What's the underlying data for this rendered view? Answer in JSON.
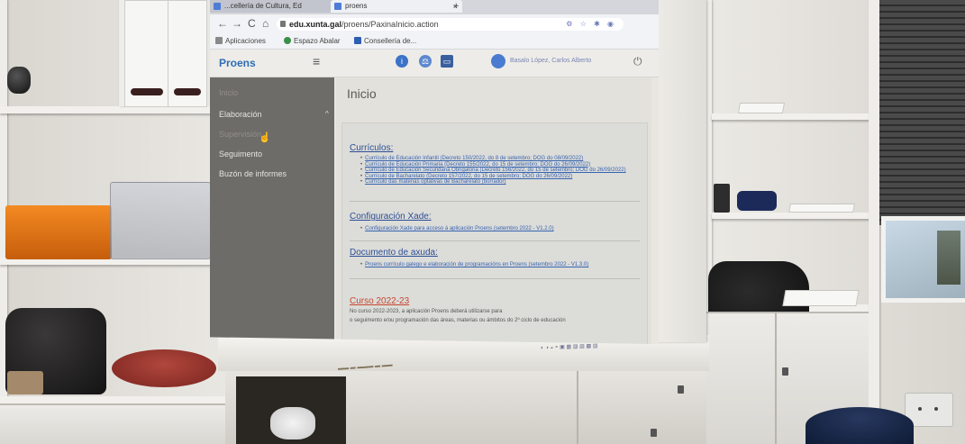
{
  "browser": {
    "tabs": [
      {
        "label": "...cellería de Cultura, Ed",
        "state": "inactive"
      },
      {
        "label": "proens",
        "state": "active"
      }
    ],
    "tab_close": "×",
    "new_tab": "+",
    "nav": {
      "back": "←",
      "forward": "→",
      "reload": "C",
      "home": "⌂"
    },
    "url_host": "edu.xunta.gal",
    "url_path": "/proens/PaxinaInicio.action",
    "bookmarks": [
      "Aplicaciones",
      "Espazo Abalar",
      "Consellería de..."
    ]
  },
  "app": {
    "brand": "Proens",
    "menu_icon": "≡",
    "user_name": "Basalo López, Carlos Alberto",
    "power_icon": "⏻",
    "sidebar": {
      "items": [
        "Inicio",
        "Elaboración",
        "Supervisión",
        "Seguimento",
        "Buzón de informes"
      ]
    },
    "page_title": "Inicio",
    "sections": [
      {
        "heading": "Currículos:",
        "items": [
          "Currículo de Educación Infantil (Decreto 150/2022, do 8 de setembro; DOG do 08/09/2022)",
          "Currículo de Educación Primaria (Decreto 155/2022, do 15 de setembro; DOG do 26/09/2022)",
          "Currículo de Educación Secundaria Obrigatoria (Decreto 156/2022, do 15 de setembro; DOG do 26/09/2022)",
          "Currículo de Bacharelato (Decreto 157/2022, do 15 de setembro; DOG do 26/09/2022)",
          "Currículo das materias optativas de Bacharelato (borrador)"
        ]
      },
      {
        "heading": "Configuración Xade:",
        "items": [
          "Configuración Xade para acceso á aplicación Proens (setembro 2022 - V1.2.0)"
        ]
      },
      {
        "heading": "Documento de axuda:",
        "items": [
          "Proens currículo galego e elaboración de programacións en Proens (setembro 2022 - V1.3.0)"
        ]
      }
    ],
    "curso": {
      "heading": "Curso 2022-23",
      "text_lines": [
        "No curso 2022-2023, a aplicación Proens deberá utilizarse para",
        "o seguimento e/ou programación das áreas, materias ou ámbitos do 2º ciclo de educación"
      ]
    }
  },
  "colors": {
    "link": "#3764b0",
    "heading": "#2d4f96",
    "curso_heading": "#c6472f",
    "brand": "#2f6db4",
    "sidebar_bg": "#6e6c69"
  },
  "icons": [
    "info-icon",
    "scales-icon",
    "inbox-icon",
    "avatar-icon",
    "power-icon",
    "hamburger-icon",
    "lock-icon",
    "mouse-cursor-icon"
  ]
}
